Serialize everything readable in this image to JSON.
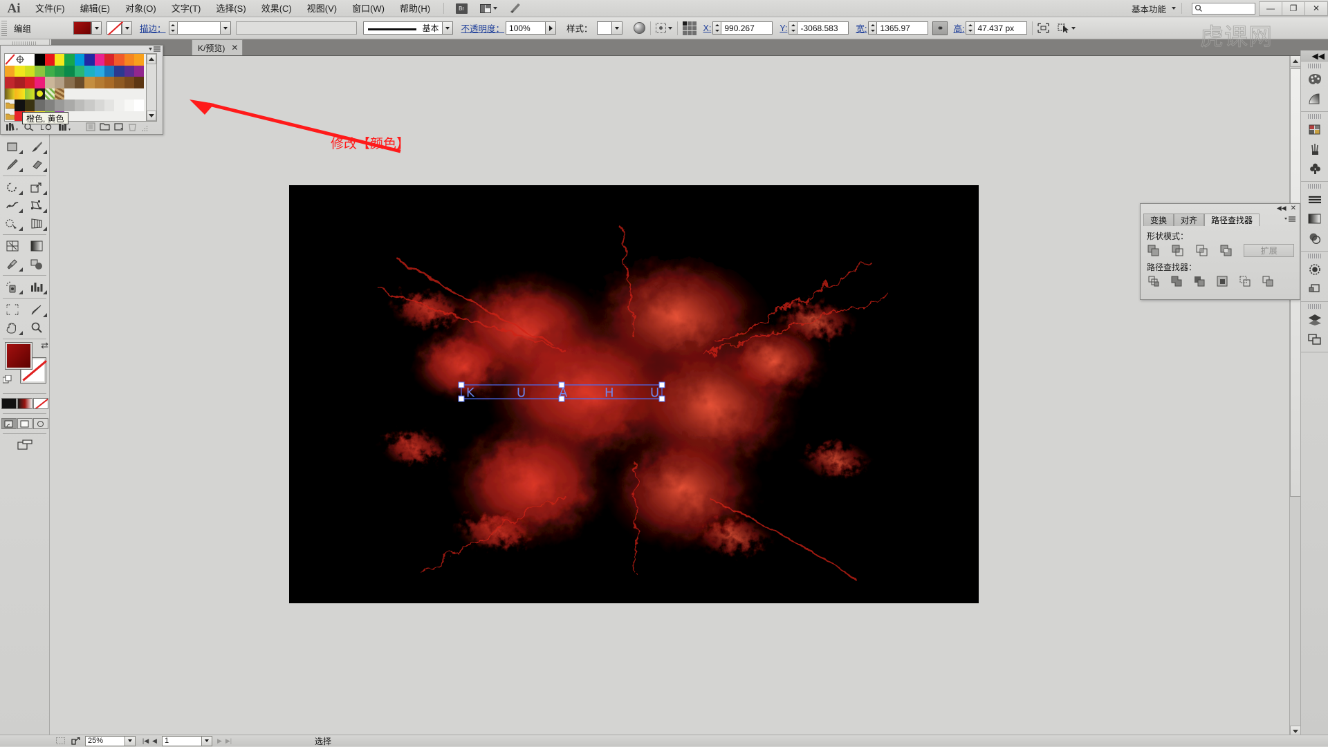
{
  "app": {
    "logo": "Ai",
    "watermark": "虎课网"
  },
  "menubar": {
    "items": [
      "文件(F)",
      "编辑(E)",
      "对象(O)",
      "文字(T)",
      "选择(S)",
      "效果(C)",
      "视图(V)",
      "窗口(W)",
      "帮助(H)"
    ],
    "bridge_label": "Br",
    "arrange_name": "arrange-documents",
    "stock_name": "stock-icon",
    "workspace": "基本功能",
    "search_placeholder": "",
    "search_value": "",
    "window_buttons": [
      "—",
      "❐",
      "✕"
    ]
  },
  "controlbar": {
    "object_type": "编组",
    "fill_color": "#8b0a08",
    "stroke_none_label": "",
    "stroke_label": "描边：",
    "stroke_weight": "",
    "stroke_profile": "",
    "brush_label": "基本",
    "opacity_label": "不透明度：",
    "opacity_value": "100%",
    "style_label": "样式：",
    "x_label": "X:",
    "x_value": "990.267",
    "y_label": "Y:",
    "y_value": "-3068.583",
    "w_label": "宽:",
    "w_value": "1365.97",
    "h_label": "高:",
    "h_value": "47.437 px",
    "link_icon": "⚭"
  },
  "tabbar": {
    "doc_title": "K/预览)",
    "close": "✕"
  },
  "swatches": {
    "panel_name": "swatches-panel",
    "tooltip": "橙色, 黄色",
    "rows": [
      [
        "none",
        "registration",
        "#ffffff",
        "#000000",
        "#e8151b",
        "#f4e81c",
        "#17a64b",
        "#0099da",
        "#2228a3",
        "#e9238f",
        "#d9242a",
        "#f15b2a",
        "#f6861f",
        "#f9a01b"
      ],
      [
        "#f5a623",
        "#f1e61c",
        "#cfe01f",
        "#8cc63e",
        "#3fae49",
        "#279b48",
        "#0a8a4b",
        "#2bb673",
        "#1cb1c4",
        "#29abe2",
        "#1b75bb",
        "#2b3990",
        "#5c2d91",
        "#92278f"
      ],
      [
        "#c1272d",
        "#a81e23",
        "#d61f26",
        "#ed1e79",
        "#cbb699",
        "#b4a087",
        "#8a6f4e",
        "#6b4d2b",
        "#c48e40",
        "#b57b32",
        "#a96b27",
        "#8f5a22",
        "#7a4a1c",
        "#5d3713"
      ],
      [
        "#g1",
        "#g2",
        "#g3",
        "#g4",
        "#p1",
        "#p2"
      ],
      [
        "#ffffff"
      ]
    ],
    "footer_icons": [
      "swatch-libraries-icon",
      "color-group-link-icon",
      "show-swatch-kinds-icon",
      "swatch-options-icon",
      "new-color-group-icon",
      "new-swatch-icon",
      "delete-swatch-icon"
    ]
  },
  "toolbar": {
    "tools": [
      {
        "name": "shape-tool",
        "glyph": "▢",
        "flyout": true
      },
      {
        "name": "paintbrush-tool",
        "glyph": "🖌",
        "flyout": true
      },
      {
        "name": "pencil-tool",
        "glyph": "✎",
        "flyout": true
      },
      {
        "name": "eraser-tool",
        "glyph": "▰",
        "flyout": true
      },
      {
        "name": "rotate-tool",
        "glyph": "↻",
        "flyout": true
      },
      {
        "name": "scale-tool",
        "glyph": "⤢",
        "flyout": true
      },
      {
        "name": "width-tool",
        "glyph": "≋",
        "flyout": true
      },
      {
        "name": "free-transform-tool",
        "glyph": "⬚",
        "flyout": true
      },
      {
        "name": "shape-builder-tool",
        "glyph": "◠",
        "flyout": true
      },
      {
        "name": "perspective-grid-tool",
        "glyph": "⌸",
        "flyout": true
      },
      {
        "name": "mesh-tool",
        "glyph": "⧈",
        "flyout": false
      },
      {
        "name": "gradient-tool",
        "glyph": "▮",
        "flyout": false
      },
      {
        "name": "eyedropper-tool",
        "glyph": "⌇",
        "flyout": true
      },
      {
        "name": "blend-tool",
        "glyph": "◑",
        "flyout": false
      },
      {
        "name": "symbol-sprayer-tool",
        "glyph": "⚱",
        "flyout": true
      },
      {
        "name": "column-graph-tool",
        "glyph": "▥",
        "flyout": true
      },
      {
        "name": "artboard-tool",
        "glyph": "⛶",
        "flyout": false
      },
      {
        "name": "slice-tool",
        "glyph": "✂",
        "flyout": true
      },
      {
        "name": "hand-tool",
        "glyph": "✋",
        "flyout": true
      },
      {
        "name": "zoom-tool",
        "glyph": "🔍",
        "flyout": false
      }
    ],
    "fill_color": "#8b0a08",
    "stroke_color": "#ffffff",
    "color_mode_buttons": [
      "color-button",
      "gradient-button",
      "none-button"
    ],
    "screen_mode_buttons": [
      "normal-screen-mode",
      "full-screen-menu-mode",
      "full-screen-mode"
    ],
    "change_screen_mode": "change-screen-mode"
  },
  "annotation": {
    "text": "修改【颜色】",
    "color": "#ff1a1a",
    "arrow_name": "red-pointer-arrow"
  },
  "canvas": {
    "artboard_bg": "#000000",
    "selection_color": "#4d6ef5",
    "artwork_description": "red-ink-splash-artwork"
  },
  "pathfinder": {
    "tabs": [
      "变换",
      "对齐",
      "路径查找器"
    ],
    "active_tab": "路径查找器",
    "shape_modes_label": "形状模式：",
    "shape_mode_buttons": [
      "unite-icon",
      "minus-front-icon",
      "intersect-icon",
      "exclude-icon"
    ],
    "expand_label": "扩展",
    "pathfinders_label": "路径查找器：",
    "pathfinder_buttons": [
      "divide-icon",
      "trim-icon",
      "merge-icon",
      "crop-icon",
      "outline-icon",
      "minus-back-icon"
    ],
    "collapse": "◀◀",
    "close": "✕"
  },
  "right_dock": {
    "collapse": "◀◀",
    "groups": [
      [
        "color-panel-icon",
        "gradient-panel-icon"
      ],
      [
        "swatches-panel-icon",
        "brushes-panel-icon",
        "symbols-panel-icon"
      ],
      [
        "stroke-panel-icon",
        "gradient2-panel-icon",
        "transparency-panel-icon"
      ],
      [
        "appearance-panel-icon",
        "graphic-styles-panel-icon"
      ],
      [
        "layers-panel-icon",
        "artboards-panel-icon"
      ]
    ]
  },
  "statusbar": {
    "artboard_icon": "artboard-nav-icon",
    "export_icon": "share-icon",
    "zoom_value": "25%",
    "first_page": "|◀",
    "prev_page": "◀",
    "page_value": "1",
    "next_page": "▶",
    "last_page": "▶|",
    "status_text": "选择"
  }
}
